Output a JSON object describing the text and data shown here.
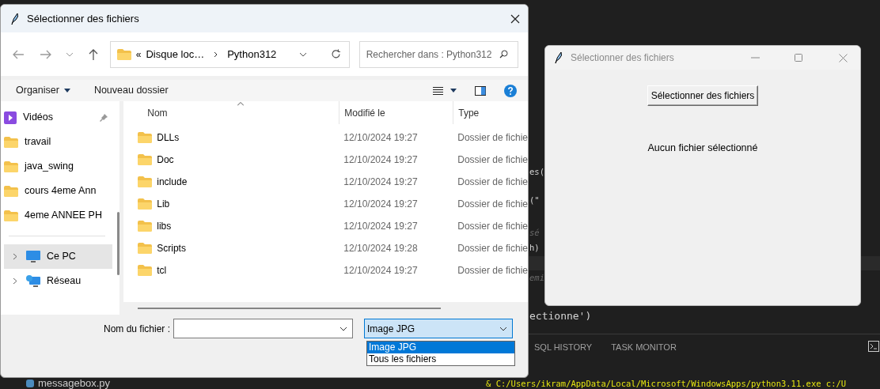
{
  "editor": {
    "code_fragments": [
      "es(",
      "(\"",
      "sé",
      "h)",
      "emi",
      "ectionne')"
    ],
    "panel_tabs": [
      "SQL HISTORY",
      "TASK MONITOR"
    ],
    "terminal": {
      "command": "& C:/Users/ikram/AppData/Local/Microsoft/WindowsApps/python3.11.exe c:/U"
    },
    "explorer_file": "messagebox.py"
  },
  "file_dialog": {
    "title": "Sélectionner des fichiers",
    "address": {
      "overflow": "«",
      "path": [
        "Disque loc…",
        "Python312"
      ]
    },
    "search": {
      "placeholder": "Rechercher dans : Python312"
    },
    "toolbar": {
      "organize": "Organiser",
      "new_folder": "Nouveau dossier"
    },
    "sidebar": [
      {
        "kind": "videos",
        "label": "Vidéos",
        "pinned": true,
        "selected": false
      },
      {
        "kind": "folder",
        "label": "travail",
        "pinned": false,
        "selected": false
      },
      {
        "kind": "folder",
        "label": "java_swing",
        "pinned": false,
        "selected": false
      },
      {
        "kind": "folder",
        "label": "cours 4eme Ann",
        "pinned": false,
        "selected": false
      },
      {
        "kind": "folder",
        "label": "4eme ANNEE PH",
        "pinned": false,
        "selected": false
      },
      {
        "kind": "pc",
        "label": "Ce PC",
        "pinned": false,
        "selected": true,
        "expanded": false
      },
      {
        "kind": "network",
        "label": "Réseau",
        "pinned": false,
        "selected": false,
        "expanded": false
      }
    ],
    "columns": [
      "Nom",
      "Modifié le",
      "Type"
    ],
    "rows": [
      {
        "name": "DLLs",
        "modified": "12/10/2024 19:27",
        "type": "Dossier de fichie"
      },
      {
        "name": "Doc",
        "modified": "12/10/2024 19:27",
        "type": "Dossier de fichie"
      },
      {
        "name": "include",
        "modified": "12/10/2024 19:27",
        "type": "Dossier de fichie"
      },
      {
        "name": "Lib",
        "modified": "12/10/2024 19:27",
        "type": "Dossier de fichie"
      },
      {
        "name": "libs",
        "modified": "12/10/2024 19:27",
        "type": "Dossier de fichie"
      },
      {
        "name": "Scripts",
        "modified": "12/10/2024 19:28",
        "type": "Dossier de fichie"
      },
      {
        "name": "tcl",
        "modified": "12/10/2024 19:27",
        "type": "Dossier de fichie"
      }
    ],
    "filename_label": "Nom du fichier :",
    "file_type": {
      "value": "Image JPG",
      "expanded": true,
      "options": [
        {
          "label": "Image JPG",
          "selected": true
        },
        {
          "label": "Tous les fichiers",
          "selected": false
        }
      ]
    }
  },
  "app_window": {
    "title": "Sélectionner des fichiers",
    "button": "Sélectionner des fichiers",
    "status": "Aucun fichier sélectionné"
  }
}
